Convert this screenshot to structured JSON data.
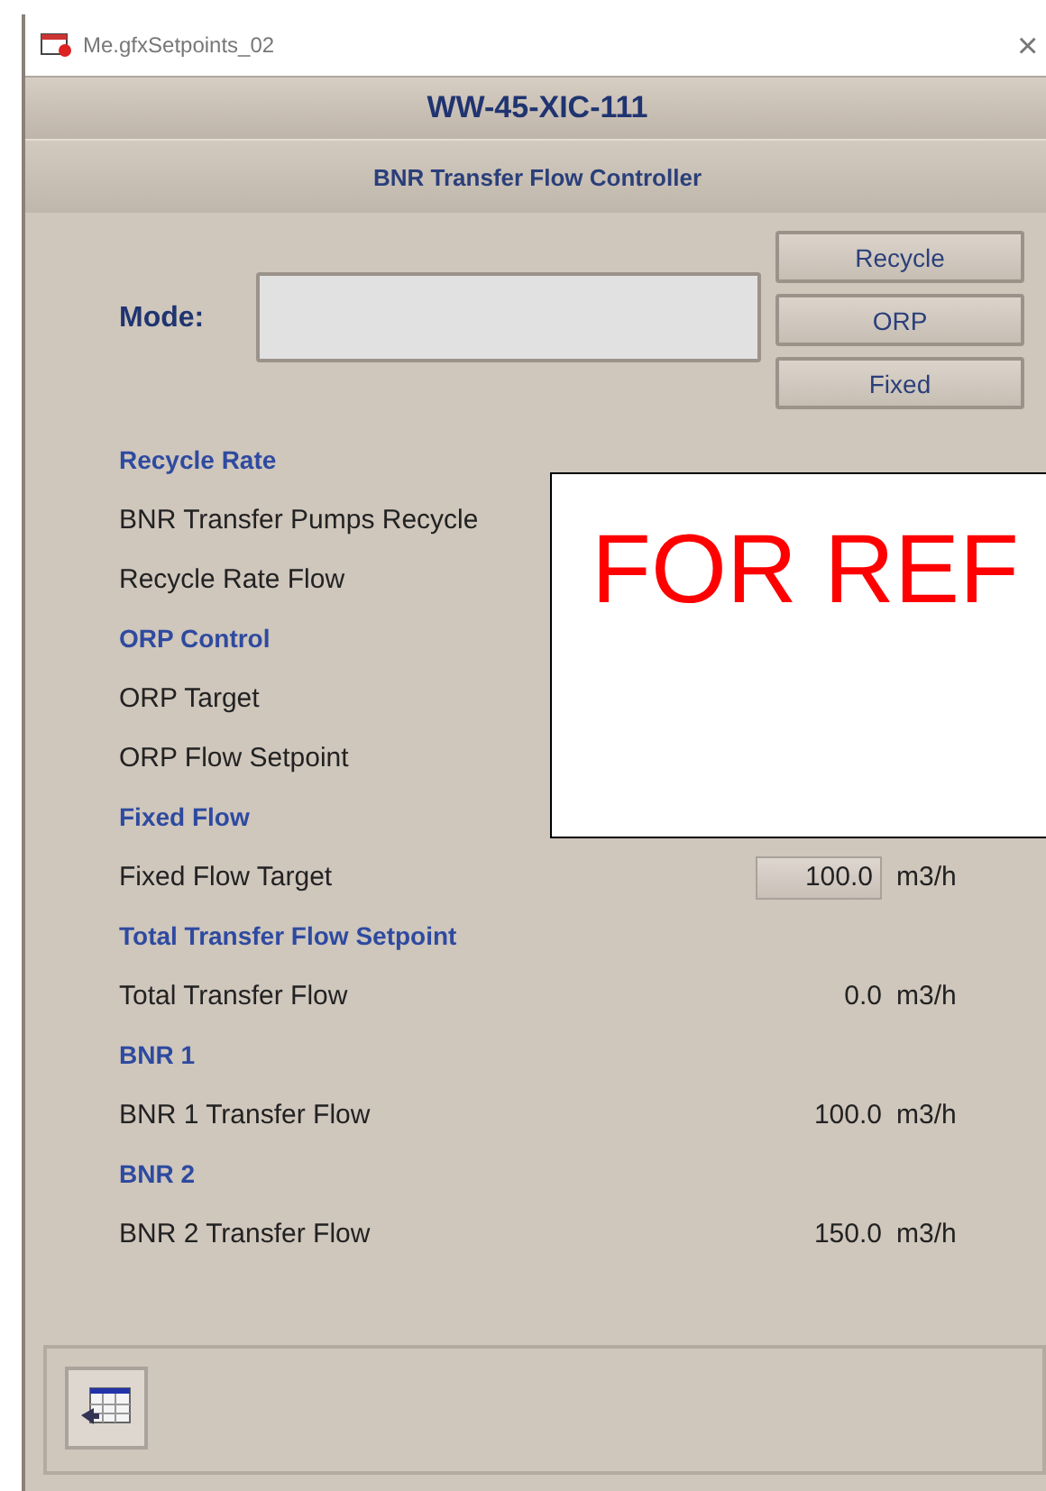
{
  "window": {
    "title": "Me.gfxSetpoints_02",
    "close": "×"
  },
  "header": {
    "tag": "WW-45-XIC-111",
    "subtitle": "BNR Transfer Flow Controller"
  },
  "mode": {
    "label": "Mode:",
    "buttons": [
      "Recycle",
      "ORP",
      "Fixed"
    ]
  },
  "items": [
    {
      "kind": "header",
      "label": "Recycle Rate"
    },
    {
      "kind": "row",
      "label": "BNR Transfer Pumps Recycle"
    },
    {
      "kind": "row",
      "label": "Recycle Rate Flow"
    },
    {
      "kind": "header",
      "label": "ORP Control"
    },
    {
      "kind": "row",
      "label": "ORP Target"
    },
    {
      "kind": "row",
      "label": "ORP Flow Setpoint"
    },
    {
      "kind": "header",
      "label": "Fixed Flow"
    },
    {
      "kind": "input",
      "label": "Fixed Flow Target",
      "value": "100.0",
      "unit": "m3/h"
    },
    {
      "kind": "header",
      "label": "Total Transfer Flow Setpoint"
    },
    {
      "kind": "row",
      "label": "Total Transfer Flow",
      "value": "0.0",
      "unit": "m3/h"
    },
    {
      "kind": "header",
      "label": "BNR 1"
    },
    {
      "kind": "row",
      "label": "BNR 1 Transfer Flow",
      "value": "100.0",
      "unit": "m3/h"
    },
    {
      "kind": "header",
      "label": "BNR 2"
    },
    {
      "kind": "row",
      "label": "BNR 2 Transfer Flow",
      "value": "150.0",
      "unit": "m3/h"
    }
  ],
  "overlay": {
    "text": "FOR REF"
  }
}
